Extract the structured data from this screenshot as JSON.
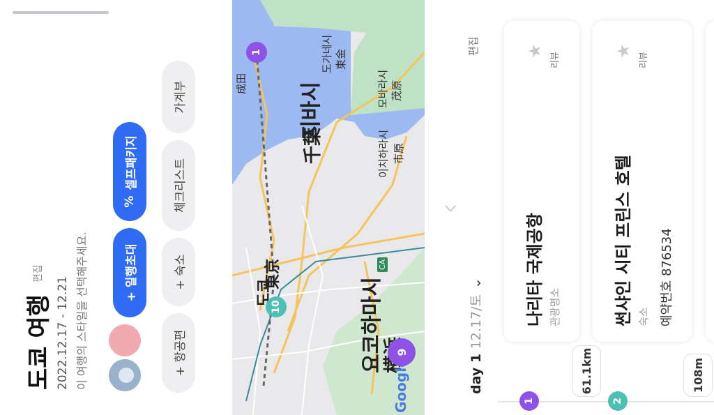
{
  "trip": {
    "title": "도쿄 여행",
    "edit_label": "편집",
    "dates": "2022.12.17 - 12.21",
    "hint": "이 여행의 스타일을 선택해주세요."
  },
  "buttons": {
    "invite": "+ 일행초대",
    "self_package": "셀프패키지",
    "flight": "+ 항공편",
    "lodging": "+ 숙소",
    "checklist": "체크리스트",
    "budget": "가계부"
  },
  "map": {
    "labels": {
      "chiba": "지바시",
      "chiba_kanji": "千葉",
      "tokyo": "도쿄",
      "tokyo_kanji": "東京",
      "yokohama": "요코하마시",
      "yokohama_kanji": "横浜",
      "narita": "成田",
      "togane": "도가네시",
      "togane_kanji": "東金",
      "mobara": "모바라시",
      "mobara_kanji": "茂原",
      "ichihara": "이치하라시",
      "ichihara_kanji": "市原",
      "road_ca": "CA",
      "google": "Google"
    },
    "markers": [
      {
        "number": "1",
        "color": "#8e53e6"
      },
      {
        "number": "10",
        "color": "#4dbfb4"
      },
      {
        "number": "9",
        "color": "#8e53e6"
      }
    ]
  },
  "itinerary": {
    "edit_label": "편집",
    "day_label": "day 1",
    "day_date": "12.17/토",
    "places": [
      {
        "number": "1",
        "color": "#8e53e6",
        "name": "나리타 국제공항",
        "category": "관광명소",
        "review": "리뷰"
      },
      {
        "number": "2",
        "color": "#4dbfb4",
        "name": "썬샤인 시티 프린스 호텔",
        "category": "숙소",
        "reservation": "예약번호 876534",
        "review": "리뷰"
      }
    ],
    "distances": [
      "61.1km",
      "108m"
    ]
  }
}
